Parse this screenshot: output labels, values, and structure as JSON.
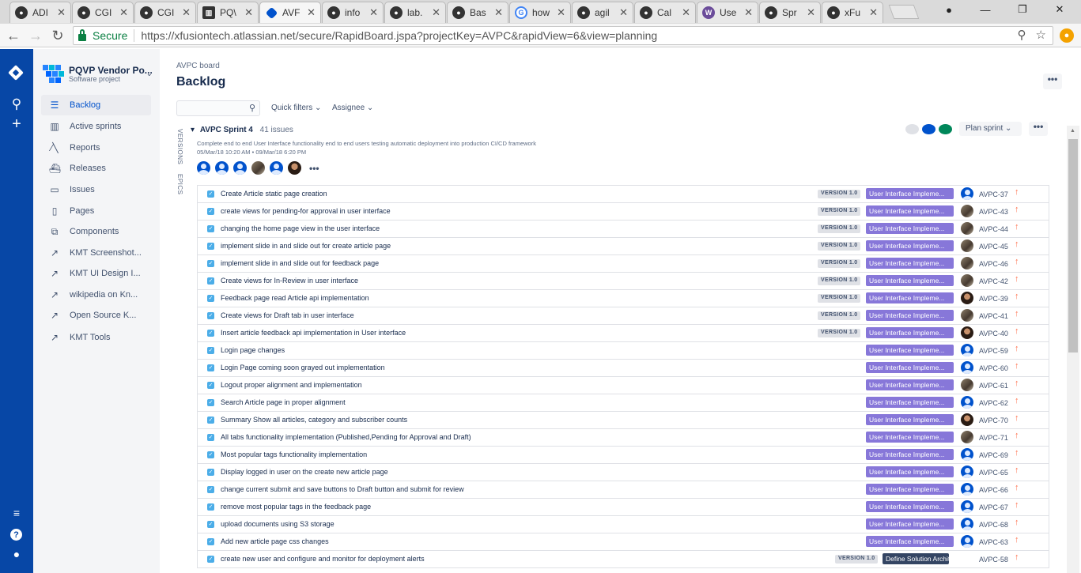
{
  "browser": {
    "tabs": [
      {
        "label": "ADI",
        "icon": "github-icon"
      },
      {
        "label": "CGI",
        "icon": "github-icon"
      },
      {
        "label": "CGI",
        "icon": "github-icon"
      },
      {
        "label": "PQ\\",
        "icon": "trello-icon"
      },
      {
        "label": "AVF",
        "icon": "jira-icon",
        "active": true
      },
      {
        "label": "info",
        "icon": "github-icon"
      },
      {
        "label": "lab.",
        "icon": "github-icon"
      },
      {
        "label": "Bas",
        "icon": "github-icon"
      },
      {
        "label": "how",
        "icon": "google-icon"
      },
      {
        "label": "agil",
        "icon": "github-icon"
      },
      {
        "label": "Cal",
        "icon": "github-icon"
      },
      {
        "label": "Use",
        "icon": "w-icon"
      },
      {
        "label": "Spr",
        "icon": "github-icon"
      },
      {
        "label": "xFu",
        "icon": "github-icon"
      }
    ],
    "secure_label": "Secure",
    "url": "https://xfusiontech.atlassian.net/secure/RapidBoard.jspa?projectKey=AVPC&rapidView=6&view=planning"
  },
  "project": {
    "name": "PQVP Vendor Po...",
    "type": "Software project"
  },
  "sidebar": {
    "items": [
      {
        "label": "Backlog",
        "icon": "backlog-icon",
        "glyph": "☰",
        "selected": true
      },
      {
        "label": "Active sprints",
        "icon": "board-icon",
        "glyph": "▥"
      },
      {
        "label": "Reports",
        "icon": "chart-icon",
        "glyph": "⁄╲"
      },
      {
        "label": "Releases",
        "icon": "ship-icon",
        "glyph": "⛴"
      },
      {
        "label": "Issues",
        "icon": "issues-icon",
        "glyph": "▭"
      },
      {
        "label": "Pages",
        "icon": "page-icon",
        "glyph": "▯"
      },
      {
        "label": "Components",
        "icon": "components-icon",
        "glyph": "⧉"
      },
      {
        "label": "KMT Screenshot...",
        "icon": "external-link-icon",
        "glyph": "↗"
      },
      {
        "label": "KMT UI Design I...",
        "icon": "external-link-icon",
        "glyph": "↗"
      },
      {
        "label": "wikipedia on Kn...",
        "icon": "external-link-icon",
        "glyph": "↗"
      },
      {
        "label": "Open Source K...",
        "icon": "external-link-icon",
        "glyph": "↗"
      },
      {
        "label": "KMT Tools",
        "icon": "external-link-icon",
        "glyph": "↗"
      }
    ]
  },
  "main": {
    "breadcrumb": "AVPC board",
    "title": "Backlog",
    "quick_filters": "Quick filters",
    "assignee": "Assignee",
    "vtab_versions": "VERSIONS",
    "vtab_epics": "EPICS"
  },
  "sprint": {
    "name": "AVPC Sprint 4",
    "count": "41 issues",
    "goal": "Complete end to end User Interface functionality end to end users testing automatic deployment into production CI/CD framework",
    "dates": "05/Mar/18 10:20 AM • 09/Mar/18 6:20 PM",
    "plan_label": "Plan sprint",
    "status_colors": [
      "#dfe1e6",
      "#0052cc",
      "#00875a"
    ]
  },
  "issues": [
    {
      "summary": "Create Article static page creation",
      "version": "VERSION 1.0",
      "epic": "User Interface Impleme...",
      "avatar": "default",
      "key": "AVPC-37"
    },
    {
      "summary": "create views for pending-for approval in user interface",
      "version": "VERSION 1.0",
      "epic": "User Interface Impleme...",
      "avatar": "p1",
      "key": "AVPC-43"
    },
    {
      "summary": "changing the home page view in the user interface",
      "version": "VERSION 1.0",
      "epic": "User Interface Impleme...",
      "avatar": "p1",
      "key": "AVPC-44"
    },
    {
      "summary": "implement slide in and slide out for create article page",
      "version": "VERSION 1.0",
      "epic": "User Interface Impleme...",
      "avatar": "p1",
      "key": "AVPC-45"
    },
    {
      "summary": "implement slide in and slide out for feedback page",
      "version": "VERSION 1.0",
      "epic": "User Interface Impleme...",
      "avatar": "p1",
      "key": "AVPC-46"
    },
    {
      "summary": "Create views for In-Review in user interface",
      "version": "VERSION 1.0",
      "epic": "User Interface Impleme...",
      "avatar": "p1",
      "key": "AVPC-42"
    },
    {
      "summary": "Feedback page read Article api implementation",
      "version": "VERSION 1.0",
      "epic": "User Interface Impleme...",
      "avatar": "p2",
      "key": "AVPC-39"
    },
    {
      "summary": "Create views for Draft tab in user interface",
      "version": "VERSION 1.0",
      "epic": "User Interface Impleme...",
      "avatar": "p1",
      "key": "AVPC-41"
    },
    {
      "summary": "Insert article feedback api implementation in User interface",
      "version": "VERSION 1.0",
      "epic": "User Interface Impleme...",
      "avatar": "p2",
      "key": "AVPC-40"
    },
    {
      "summary": "Login page changes",
      "version": "",
      "epic": "User Interface Impleme...",
      "avatar": "default",
      "key": "AVPC-59"
    },
    {
      "summary": "Login Page coming soon grayed out implementation",
      "version": "",
      "epic": "User Interface Impleme...",
      "avatar": "default",
      "key": "AVPC-60"
    },
    {
      "summary": "Logout proper alignment and implementation",
      "version": "",
      "epic": "User Interface Impleme...",
      "avatar": "p1",
      "key": "AVPC-61"
    },
    {
      "summary": "Search Article page in proper alignment",
      "version": "",
      "epic": "User Interface Impleme...",
      "avatar": "default",
      "key": "AVPC-62"
    },
    {
      "summary": "Summary Show all articles, category and subscriber counts",
      "version": "",
      "epic": "User Interface Impleme...",
      "avatar": "p2",
      "key": "AVPC-70"
    },
    {
      "summary": "All tabs functionality implementation (Published,Pending for Approval and Draft)",
      "version": "",
      "epic": "User Interface Impleme...",
      "avatar": "p1",
      "key": "AVPC-71"
    },
    {
      "summary": "Most popular tags functionality implementation",
      "version": "",
      "epic": "User Interface Impleme...",
      "avatar": "default",
      "key": "AVPC-69"
    },
    {
      "summary": "Display logged in user on the create new article page",
      "version": "",
      "epic": "User Interface Impleme...",
      "avatar": "default",
      "key": "AVPC-65"
    },
    {
      "summary": "change current submit and save buttons to Draft button and submit for review",
      "version": "",
      "epic": "User Interface Impleme...",
      "avatar": "default",
      "key": "AVPC-66"
    },
    {
      "summary": "remove most popular tags in the feedback page",
      "version": "",
      "epic": "User Interface Impleme...",
      "avatar": "default",
      "key": "AVPC-67"
    },
    {
      "summary": "upload documents using S3 storage",
      "version": "",
      "epic": "User Interface Impleme...",
      "avatar": "default",
      "key": "AVPC-68"
    },
    {
      "summary": "Add new article page css changes",
      "version": "",
      "epic": "User Interface Impleme...",
      "avatar": "default",
      "key": "AVPC-63"
    },
    {
      "summary": "create new user and configure and monitor for deployment alerts",
      "version": "VERSION 1.0",
      "epic": "Define Solution Archite...",
      "epic_dark": true,
      "avatar": "none",
      "key": "AVPC-58"
    }
  ]
}
